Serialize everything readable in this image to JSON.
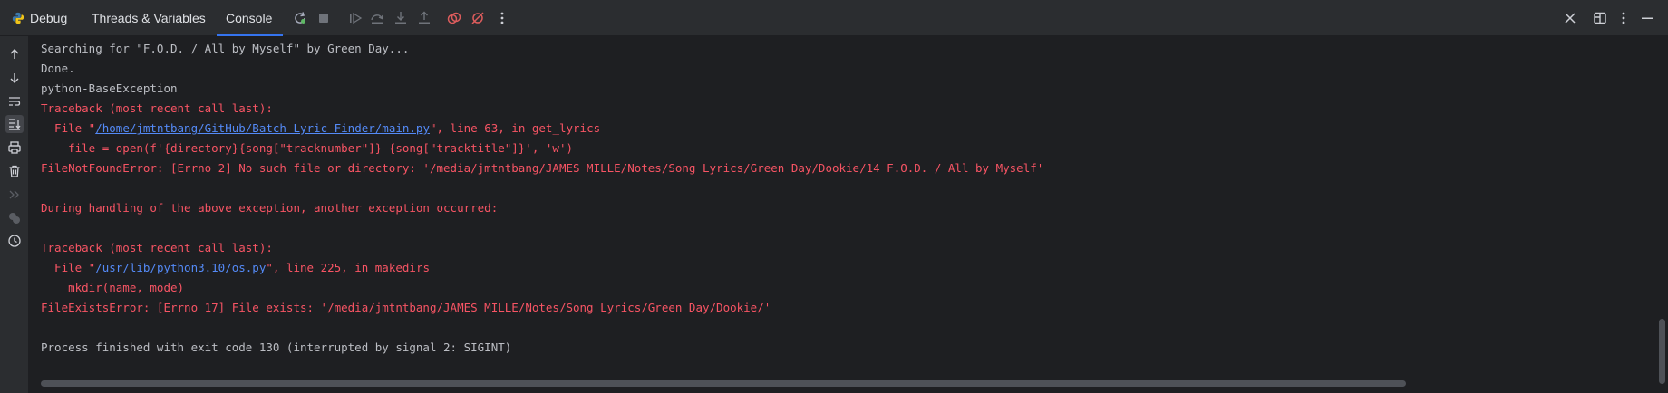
{
  "header": {
    "title": "Debug",
    "tabs": [
      {
        "label": "Threads & Variables"
      },
      {
        "label": "Console"
      }
    ],
    "active_tab": "Console"
  },
  "toolbar": {
    "icons": [
      "rerun-icon",
      "stop-icon",
      "resume-icon",
      "step-over-icon",
      "step-into-icon",
      "step-out-icon",
      "view-breakpoints-icon",
      "mute-breakpoints-icon",
      "more-icon"
    ],
    "right_icons": [
      "close-icon",
      "layout-icon",
      "more-vertical-icon",
      "minimize-icon"
    ]
  },
  "gutter": {
    "icons": [
      "up-arrow-icon",
      "down-arrow-icon",
      "soft-wrap-icon",
      "scroll-to-end-icon",
      "print-icon",
      "trash-icon",
      "expand-icon",
      "python-console-icon",
      "history-icon"
    ]
  },
  "console": {
    "l1": "Searching for \"F.O.D. / All by Myself\" by Green Day...",
    "l2": "Done.",
    "l3": "python-BaseException",
    "l4": "Traceback (most recent call last):",
    "l5_pre": "  File \"",
    "l5_link": "/home/jmtntbang/GitHub/Batch-Lyric-Finder/main.py",
    "l5_post": "\", line 63, in get_lyrics",
    "l6": "    file = open(f'{directory}{song[\"tracknumber\"]} {song[\"tracktitle\"]}', 'w')",
    "l7": "FileNotFoundError: [Errno 2] No such file or directory: '/media/jmtntbang/JAMES MILLE/Notes/Song Lyrics/Green Day/Dookie/14 F.O.D. / All by Myself'",
    "l8": "During handling of the above exception, another exception occurred:",
    "l9": "Traceback (most recent call last):",
    "l10_pre": "  File \"",
    "l10_link": "/usr/lib/python3.10/os.py",
    "l10_post": "\", line 225, in makedirs",
    "l11": "    mkdir(name, mode)",
    "l12": "FileExistsError: [Errno 17] File exists: '/media/jmtntbang/JAMES MILLE/Notes/Song Lyrics/Green Day/Dookie/'",
    "l13": "Process finished with exit code 130 (interrupted by signal 2: SIGINT)"
  },
  "colors": {
    "background": "#1e1f22",
    "panel": "#2b2d30",
    "text": "#bcbec4",
    "error": "#f75464",
    "link": "#548af7",
    "accent": "#3574f0"
  }
}
